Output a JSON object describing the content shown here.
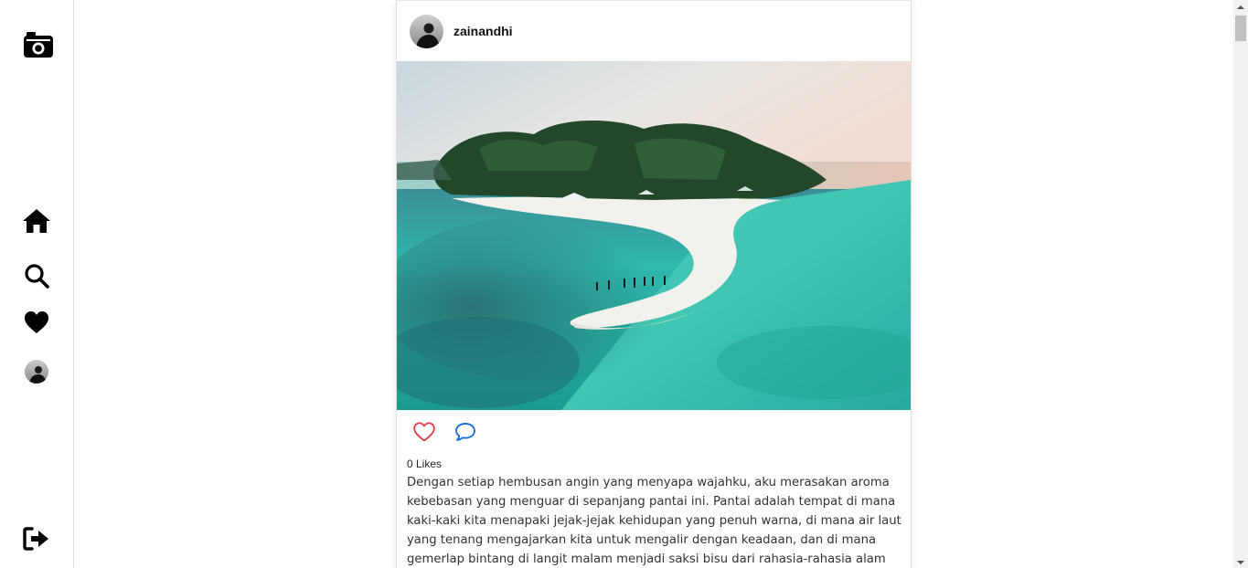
{
  "sidebar": {
    "logo_icon": "camera-icon",
    "items": [
      {
        "icon": "home-icon"
      },
      {
        "icon": "search-icon"
      },
      {
        "icon": "heart-icon"
      },
      {
        "icon": "avatar"
      },
      {
        "icon": "logout-icon"
      }
    ]
  },
  "post": {
    "username": "zainandhi",
    "likes_text": "0 Likes",
    "caption": "Dengan setiap hembusan angin yang menyapa wajahku, aku merasakan aroma kebebasan yang menguar di sepanjang pantai ini. Pantai adalah tempat di mana kaki-kaki kita menapaki jejak-jejak kehidupan yang penuh warna, di mana air laut yang tenang mengajarkan kita untuk mengalir dengan keadaan, dan di mana gemerlap bintang di langit malam menjadi saksi bisu dari rahasia-rahasia alam yang tak terduga.",
    "like_color": "#e0434b",
    "comment_color": "#1a6fe0"
  }
}
